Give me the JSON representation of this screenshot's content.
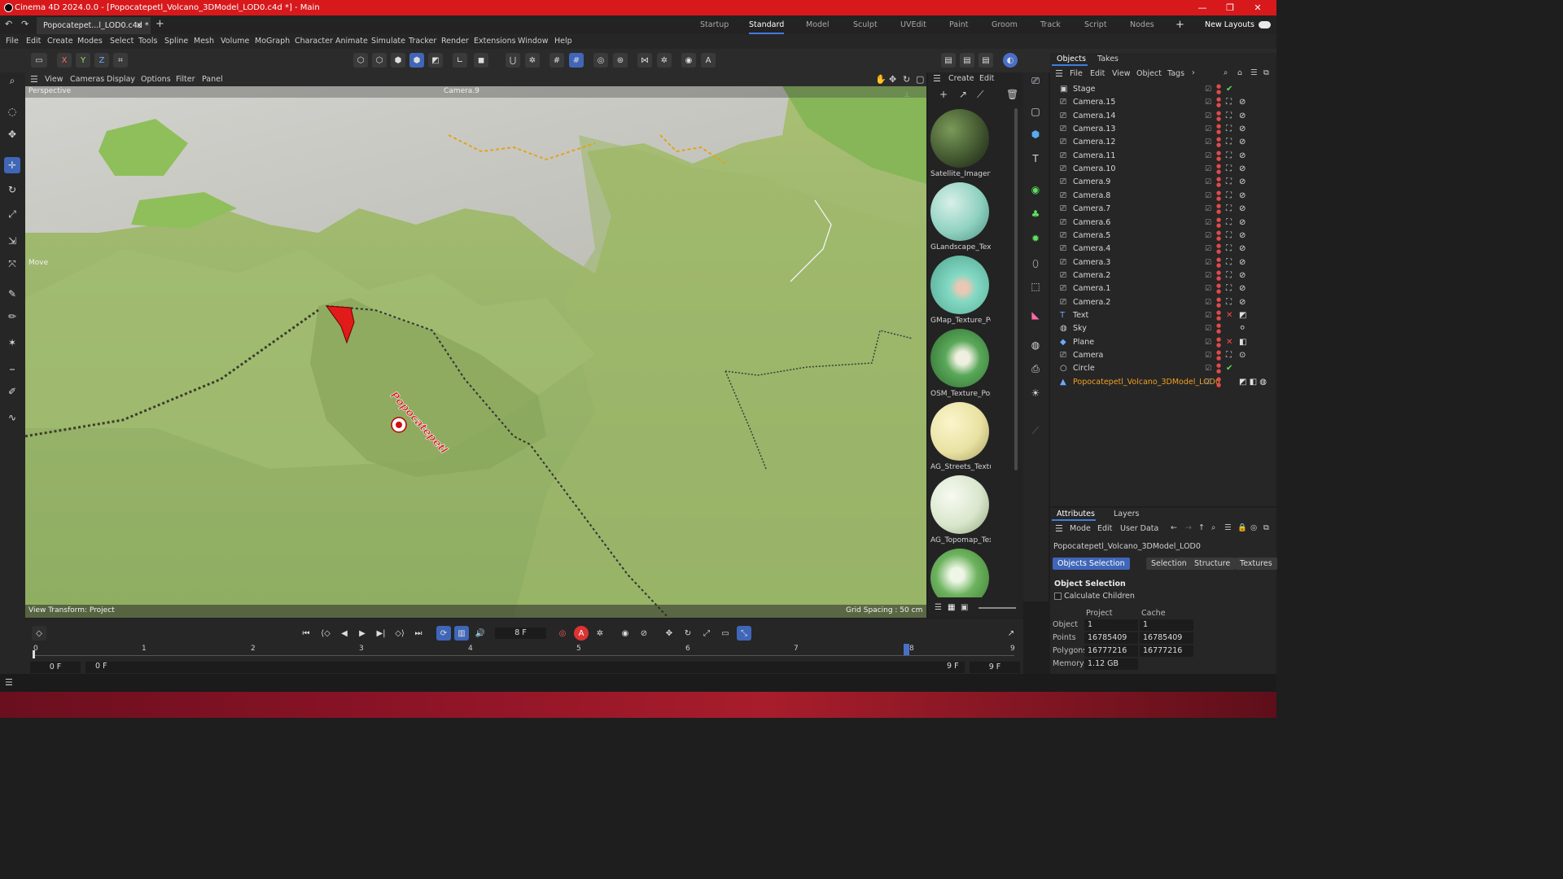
{
  "window": {
    "title": "Cinema 4D 2024.0.0 - [Popocatepetl_Volcano_3DModel_LOD0.c4d *] - Main",
    "controls": [
      "—",
      "❐",
      "✕"
    ]
  },
  "doc_tab": {
    "label": "Popocatepet...l_LOD0.c4d *",
    "close": "×",
    "add": "+"
  },
  "layouts": {
    "items": [
      "Startup",
      "Standard",
      "Model",
      "Sculpt",
      "UVEdit",
      "Paint",
      "Groom",
      "Track",
      "Script",
      "Nodes"
    ],
    "active": "Standard",
    "add": "+",
    "new_layouts": "New Layouts"
  },
  "menu": [
    "File",
    "Edit",
    "Create",
    "Modes",
    "Select",
    "Tools",
    "Spline",
    "Mesh",
    "Volume",
    "MoGraph",
    "Character",
    "Animate",
    "Simulate",
    "Tracker",
    "Render",
    "Extensions",
    "Window",
    "Help"
  ],
  "toolbar": {
    "axes": [
      "X",
      "Y",
      "Z"
    ]
  },
  "viewport": {
    "menu": [
      "View",
      "Cameras",
      "Display",
      "Options",
      "Filter",
      "Panel"
    ],
    "projection": "Perspective",
    "camera": "Camera.9",
    "tool_label": "Move",
    "view_transform": "View Transform: Project",
    "grid_spacing": "Grid Spacing : 50 cm",
    "scene_label": "Popocatepetl"
  },
  "materials": {
    "menu": [
      "Create",
      "Edit"
    ],
    "items": [
      {
        "label": "Satellite_Imagery_",
        "color": "#4a5a34"
      },
      {
        "label": "GLandscape_Textu",
        "color": "#8fd1c0"
      },
      {
        "label": "GMap_Texture_Po",
        "color": "#83d9c4"
      },
      {
        "label": "OSM_Texture_Pop",
        "color": "#5aa85a"
      },
      {
        "label": "AG_Streets_Textur",
        "color": "#e9e2a3"
      },
      {
        "label": "AG_Topomap_Tex",
        "color": "#d9e6cc"
      },
      {
        "label": "",
        "color": "#6db35e"
      }
    ]
  },
  "objects": {
    "tabs": [
      "Objects",
      "Takes"
    ],
    "menu": [
      "File",
      "Edit",
      "View",
      "Object",
      "Tags"
    ],
    "items": [
      {
        "name": "Stage"
      },
      {
        "name": "Camera.15"
      },
      {
        "name": "Camera.14"
      },
      {
        "name": "Camera.13"
      },
      {
        "name": "Camera.12"
      },
      {
        "name": "Camera.11"
      },
      {
        "name": "Camera.10"
      },
      {
        "name": "Camera.9"
      },
      {
        "name": "Camera.8"
      },
      {
        "name": "Camera.7"
      },
      {
        "name": "Camera.6"
      },
      {
        "name": "Camera.5"
      },
      {
        "name": "Camera.4"
      },
      {
        "name": "Camera.3"
      },
      {
        "name": "Camera.2"
      },
      {
        "name": "Camera.1"
      },
      {
        "name": "Camera.2"
      },
      {
        "name": "Text"
      },
      {
        "name": "Sky"
      },
      {
        "name": "Plane"
      },
      {
        "name": "Camera"
      },
      {
        "name": "Circle"
      },
      {
        "name": "Popocatepetl_Volcano_3DModel_LOD0"
      }
    ]
  },
  "attributes": {
    "tabs": [
      "Attributes",
      "Layers"
    ],
    "menu": [
      "Mode",
      "Edit",
      "User Data"
    ],
    "object_name": "Popocatepetl_Volcano_3DModel_LOD0",
    "subtabs": [
      "Objects Selection",
      "Selection",
      "Structure",
      "Textures"
    ],
    "section": "Object Selection",
    "calc_children": "Calculate Children",
    "col_project": "Project",
    "col_cache": "Cache",
    "rows": [
      {
        "label": "Object",
        "project": "1",
        "cache": "1"
      },
      {
        "label": "Points",
        "project": "16785409",
        "cache": "16785409"
      },
      {
        "label": "Polygons",
        "project": "16777216",
        "cache": "16777216"
      },
      {
        "label": "Memory",
        "project": "1.12 GB",
        "cache": ""
      }
    ]
  },
  "timeline": {
    "current_frame": "8 F",
    "start": "0 F",
    "start2": "0 F",
    "end": "9 F",
    "end2": "9 F",
    "ticks": [
      "0",
      "1",
      "2",
      "3",
      "4",
      "5",
      "6",
      "7",
      "8",
      "9"
    ]
  },
  "colors": {
    "accent": "#3f66b8",
    "title_bar": "#d7191c",
    "active_layout": "#3f7de0"
  }
}
